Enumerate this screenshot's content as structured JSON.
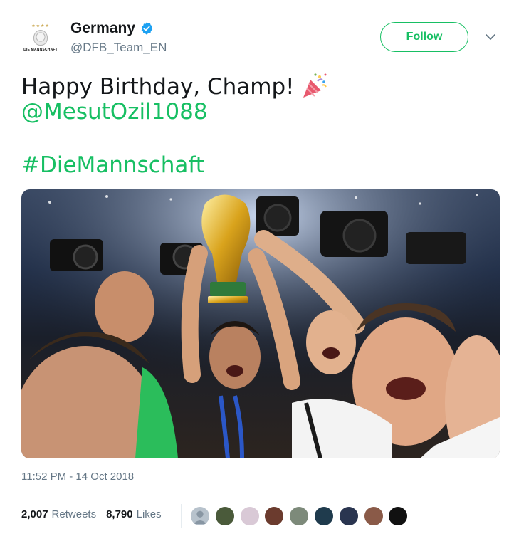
{
  "account": {
    "name": "Germany",
    "handle": "@DFB_Team_EN",
    "avatar_text": "DIE MANNSCHAFT",
    "verified": true
  },
  "follow_label": "Follow",
  "tweet": {
    "line1": "Happy Birthday, Champ!",
    "emoji": "party-popper-icon",
    "mention": "@MesutOzil1088",
    "hashtag": "#DieMannschaft"
  },
  "media": {
    "type": "photo"
  },
  "timestamp": "11:52 PM - 14 Oct 2018",
  "stats": {
    "retweets_count": "2,007",
    "retweets_label": "Retweets",
    "likes_count": "8,790",
    "likes_label": "Likes"
  },
  "likers": [
    {
      "color": "#b7c2cc"
    },
    {
      "color": "#4a5a3a"
    },
    {
      "color": "#d9c9d6"
    },
    {
      "color": "#6b3b2e"
    },
    {
      "color": "#7d8a7a"
    },
    {
      "color": "#1f3b4d"
    },
    {
      "color": "#2a3550"
    },
    {
      "color": "#8a5a48"
    },
    {
      "color": "#111111"
    }
  ],
  "colors": {
    "accent": "#17bf63",
    "text_secondary": "#657786",
    "verified": "#1da1f2"
  }
}
